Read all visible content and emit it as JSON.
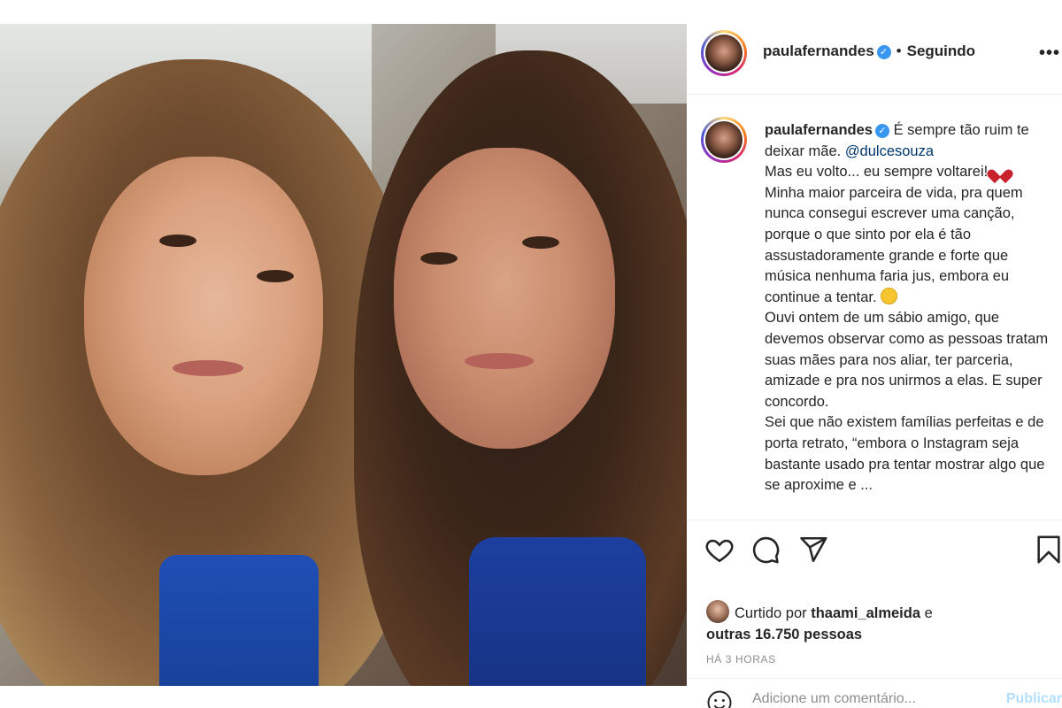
{
  "post": {
    "author": {
      "username": "paulafernandes",
      "verified": true,
      "follow_status": "Seguindo"
    },
    "caption": {
      "username": "paulafernandes",
      "line1_text": "É sempre tão ruim te deixar mãe.",
      "mention": "@dulcesouza",
      "line2_text": "Mas eu volto... eu sempre voltarei!",
      "line2_emoji": "heart-emoji",
      "line3_text": "Minha maior parceira de vida, pra quem nunca consegui escrever uma canção, porque o que sinto por ela é tão assustadoramente grande e forte que música nenhuma faria jus, embora eu continue a tentar.",
      "line3_emoji": "smile-emoji",
      "line4_text": "Ouvi ontem de um sábio amigo, que devemos observar como as pessoas tratam suas mães para nos aliar, ter parceria, amizade e pra nos unirmos a elas. E super concordo.",
      "line5_text": "Sei que não existem famílias perfeitas e de porta retrato, “embora o Instagram seja bastante usado pra tentar mostrar algo que se aproxime e ..."
    },
    "likes": {
      "prefix": "Curtido por",
      "liker": "thaami_almeida",
      "conjunction": "e",
      "others": "outras 16.750 pessoas"
    },
    "time_ago": "HÁ 3 HORAS",
    "comment": {
      "placeholder": "Adicione um comentário...",
      "publish_label": "Publicar"
    }
  },
  "icons": {
    "more": "more-options-icon",
    "like": "heart-icon",
    "comment": "comment-icon",
    "share": "share-icon",
    "save": "bookmark-icon",
    "emoji": "emoji-icon"
  },
  "colors": {
    "verified": "#3897f0",
    "mention": "#00376b",
    "muted": "#8e8e8e",
    "publish": "#b2dffc"
  }
}
